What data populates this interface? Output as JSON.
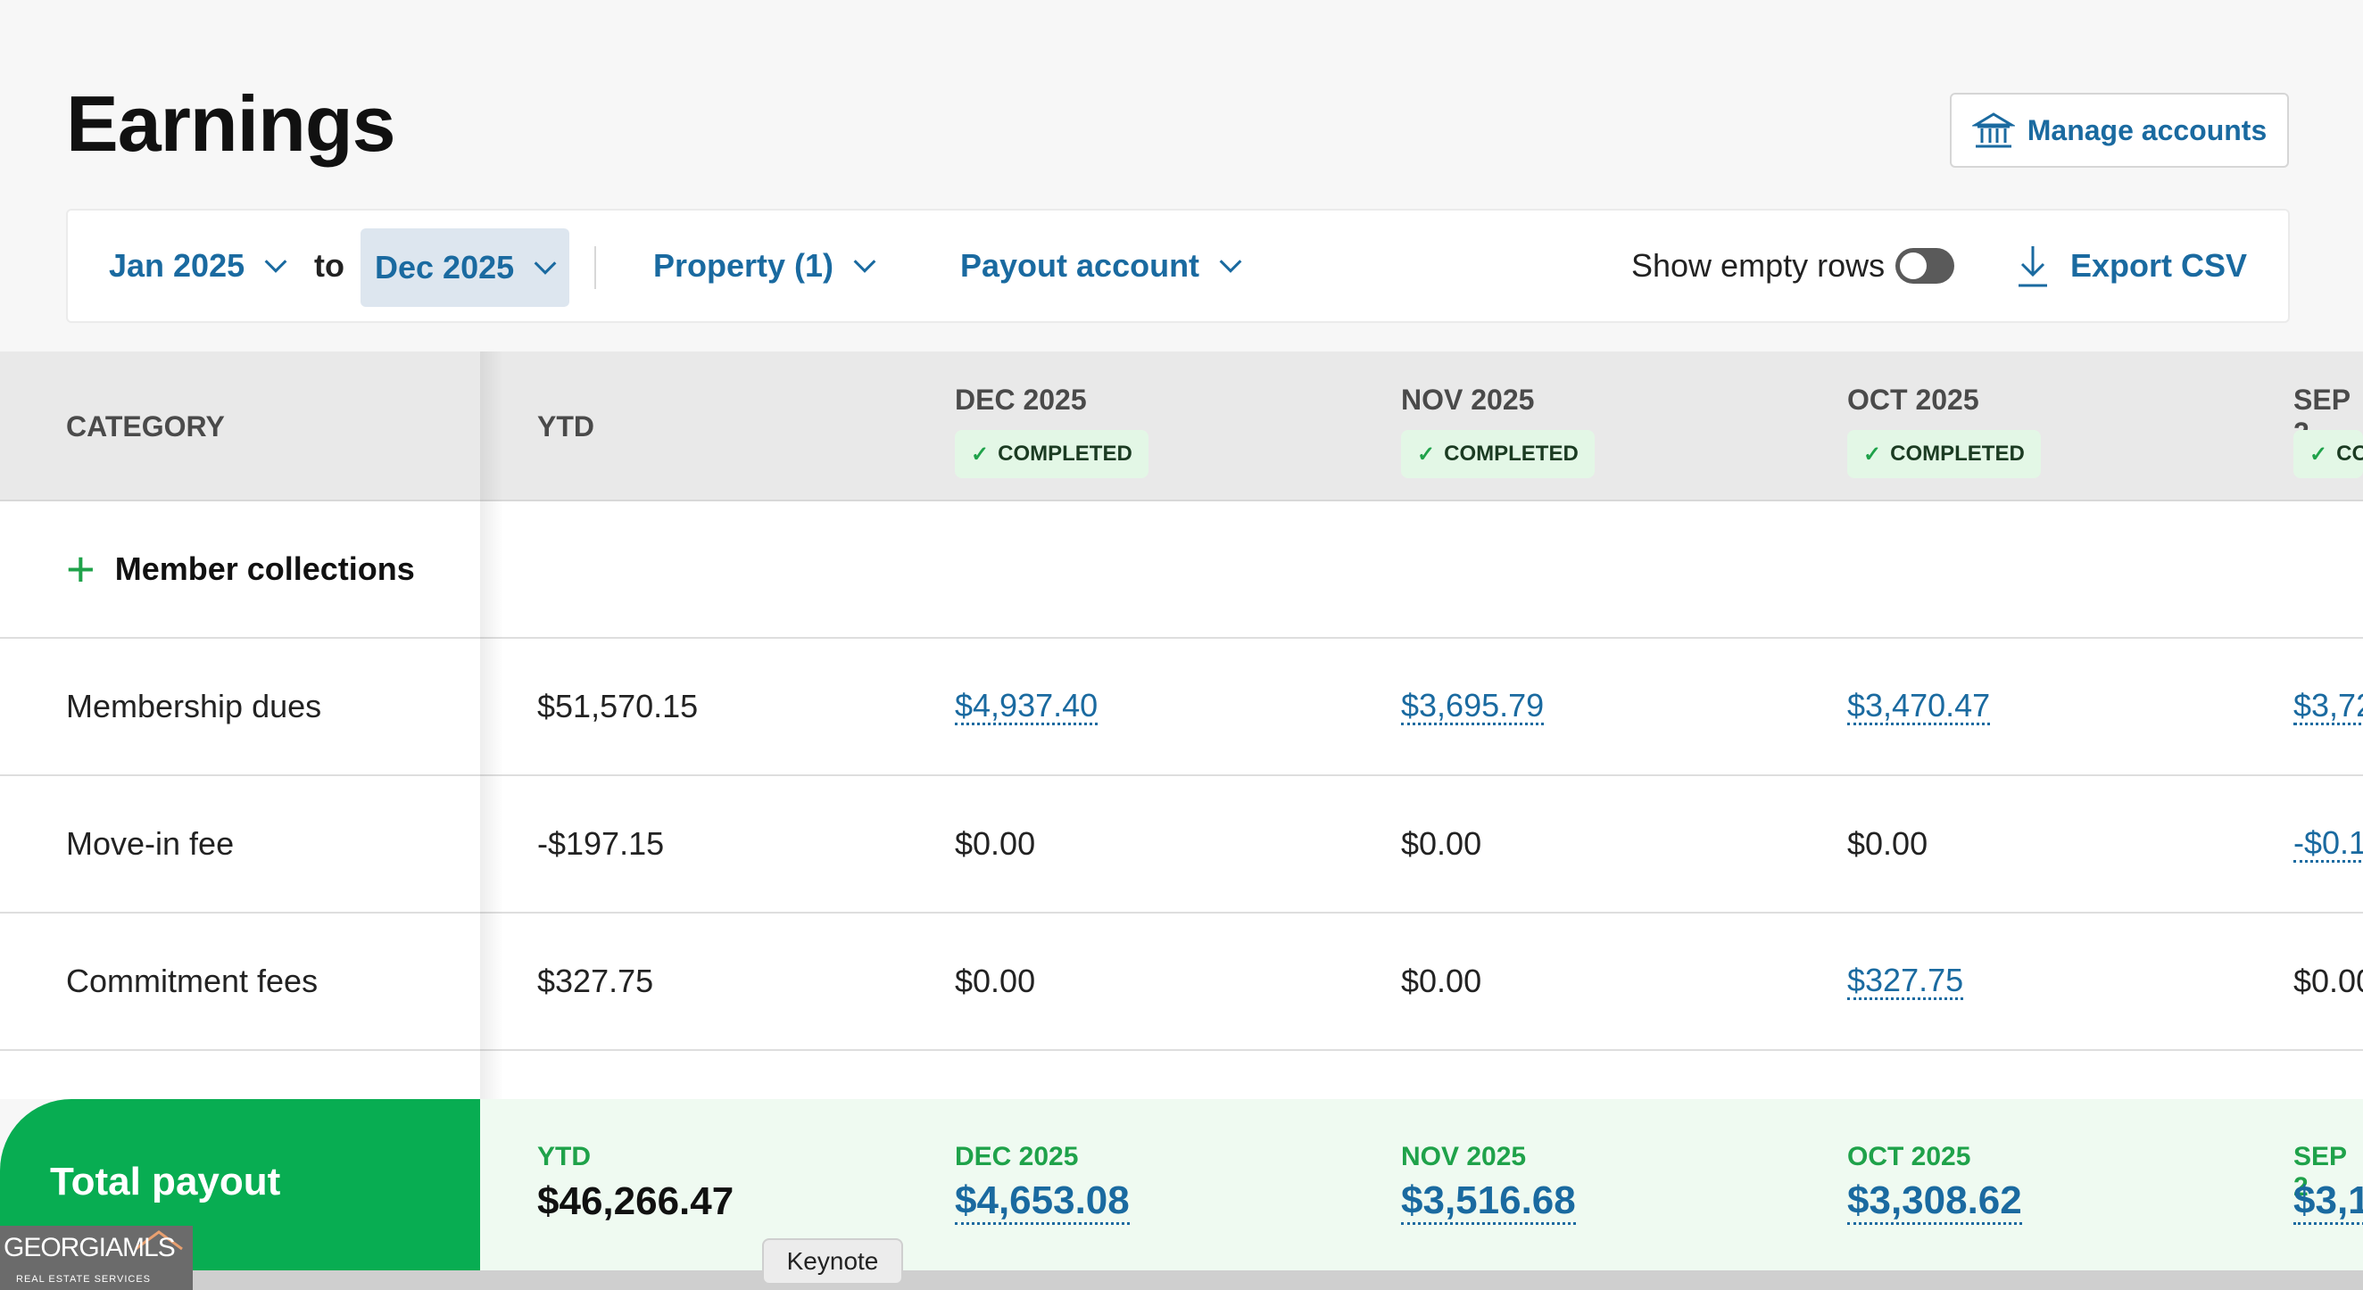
{
  "header": {
    "title": "Earnings",
    "manage_accounts_label": "Manage accounts"
  },
  "filters": {
    "date_from": "Jan 2025",
    "to_text": "to",
    "date_to": "Dec 2025",
    "property": "Property (1)",
    "payout_account": "Payout account",
    "show_empty_rows": "Show empty rows",
    "show_empty_rows_on": false,
    "export_label": "Export CSV"
  },
  "table": {
    "category_header": "CATEGORY",
    "ytd_header": "YTD",
    "months": [
      {
        "label": "DEC 2025",
        "status": "COMPLETED"
      },
      {
        "label": "NOV 2025",
        "status": "COMPLETED"
      },
      {
        "label": "OCT 2025",
        "status": "COMPLETED"
      },
      {
        "label": "SEP 2",
        "status": "CO"
      }
    ],
    "group": {
      "label": "Member collections"
    },
    "rows": [
      {
        "category": "Membership dues",
        "ytd": "$51,570.15",
        "values": [
          "$4,937.40",
          "$3,695.79",
          "$3,470.47",
          "$3,72"
        ]
      },
      {
        "category": "Move-in fee",
        "ytd": "-$197.15",
        "values": [
          "$0.00",
          "$0.00",
          "$0.00",
          "-$0.1"
        ]
      },
      {
        "category": "Commitment fees",
        "ytd": "$327.75",
        "values": [
          "$0.00",
          "$0.00",
          "$327.75",
          "$0.00"
        ]
      }
    ]
  },
  "total_payout": {
    "label": "Total payout",
    "ytd_label": "YTD",
    "ytd_value": "$46,266.47",
    "months": [
      {
        "label": "DEC 2025",
        "value": "$4,653.08"
      },
      {
        "label": "NOV 2025",
        "value": "$3,516.68"
      },
      {
        "label": "OCT 2025",
        "value": "$3,308.62"
      },
      {
        "label": "SEP 2",
        "value": "$3,1"
      }
    ]
  },
  "overlay": {
    "logo_text": "GEORGIAMLS",
    "logo_sub": "REAL ESTATE SERVICES",
    "tooltip": "Keynote"
  },
  "colors": {
    "accent": "#1a6aa0",
    "green": "#08ad52",
    "badge_bg": "#e3f7e6"
  }
}
